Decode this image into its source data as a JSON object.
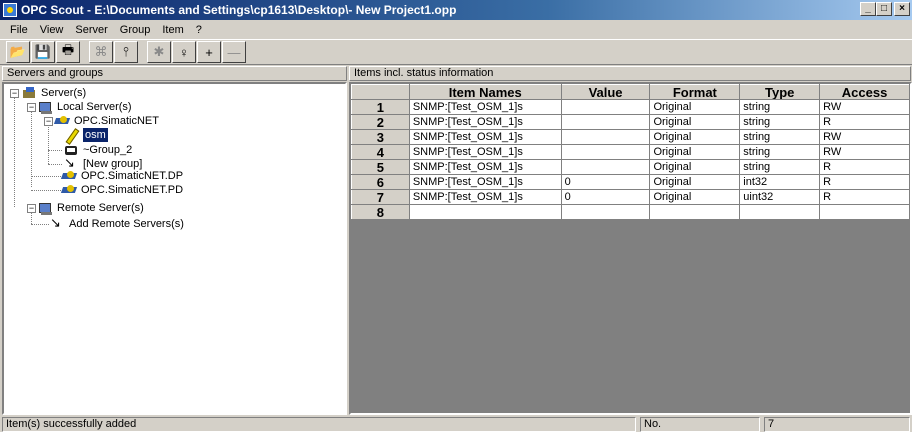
{
  "window": {
    "title": "OPC Scout - E:\\Documents and Settings\\cp1613\\Desktop\\- New Project1.opp",
    "minimize": "_",
    "maximize": "□",
    "close": "×"
  },
  "menu": [
    "File",
    "View",
    "Server",
    "Group",
    "Item",
    "?"
  ],
  "toolbar": {
    "buttons": [
      {
        "icon": "open-folder-icon",
        "glyph": "📂"
      },
      {
        "icon": "save-icon",
        "glyph": "💾"
      },
      {
        "icon": "print-icon",
        "glyph": "🖶"
      },
      {
        "icon": "network-icon",
        "glyph": "⌘"
      },
      {
        "icon": "tree-icon",
        "glyph": "⫯"
      },
      {
        "icon": "server-disabled-icon",
        "glyph": "✱"
      },
      {
        "icon": "bulb-icon",
        "glyph": "♀"
      },
      {
        "icon": "add-item-icon",
        "glyph": "+"
      },
      {
        "icon": "remove-item-icon",
        "glyph": "—"
      }
    ]
  },
  "left_pane": {
    "header": "Servers and groups",
    "tree": [
      {
        "label": "Server(s)"
      },
      {
        "label": "Local Server(s)"
      },
      {
        "label": "OPC.SimaticNET"
      },
      {
        "label": "osm",
        "selected": true
      },
      {
        "label": "~Group_2"
      },
      {
        "label": "[New group]"
      },
      {
        "label": "OPC.SimaticNET.DP"
      },
      {
        "label": "OPC.SimaticNET.PD"
      },
      {
        "label": "Remote Server(s)"
      },
      {
        "label": "Add Remote Servers(s)"
      }
    ]
  },
  "right_pane": {
    "header": "Items incl. status information",
    "columns": [
      "Item Names",
      "Value",
      "Format",
      "Type",
      "Access"
    ],
    "rows": [
      {
        "num": "1",
        "cells": [
          "SNMP:[Test_OSM_1]s",
          "",
          "Original",
          "string",
          "RW"
        ]
      },
      {
        "num": "2",
        "cells": [
          "SNMP:[Test_OSM_1]s",
          "",
          "Original",
          "string",
          "R"
        ]
      },
      {
        "num": "3",
        "cells": [
          "SNMP:[Test_OSM_1]s",
          "",
          "Original",
          "string",
          "RW"
        ]
      },
      {
        "num": "4",
        "cells": [
          "SNMP:[Test_OSM_1]s",
          "",
          "Original",
          "string",
          "RW"
        ]
      },
      {
        "num": "5",
        "cells": [
          "SNMP:[Test_OSM_1]s",
          "",
          "Original",
          "string",
          "R"
        ]
      },
      {
        "num": "6",
        "cells": [
          "SNMP:[Test_OSM_1]s",
          "0",
          "Original",
          "int32",
          "R"
        ]
      },
      {
        "num": "7",
        "cells": [
          "SNMP:[Test_OSM_1]s",
          "0",
          "Original",
          "uint32",
          "R"
        ]
      },
      {
        "num": "8",
        "cells": [
          "",
          "",
          "",
          "",
          ""
        ]
      }
    ]
  },
  "statusbar": {
    "message": "Item(s) successfully added",
    "no_label": "No.",
    "count": "7"
  }
}
